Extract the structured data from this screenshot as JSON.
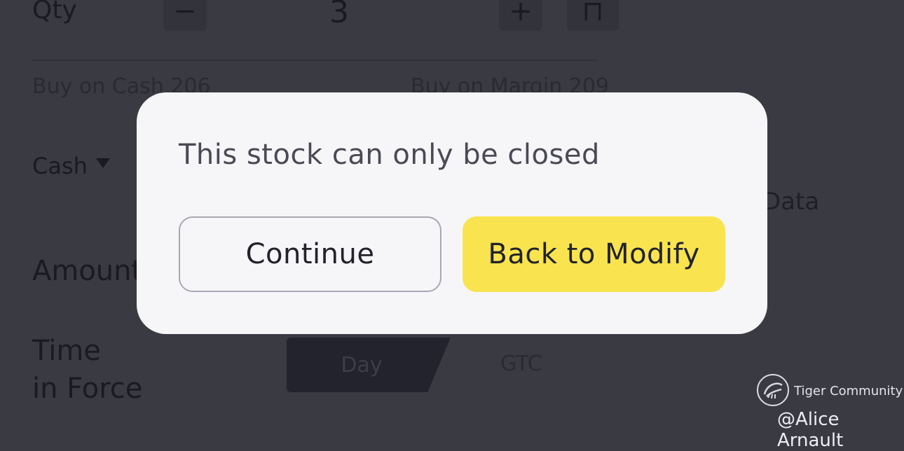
{
  "order_form": {
    "qty_label": "Qty",
    "qty_value": "3",
    "minus_symbol": "−",
    "plus_symbol": "+",
    "extra_symbol": "⊓",
    "buy_on_cash": "Buy on Cash 206",
    "buy_on_margin": "Buy on Margin 209",
    "account_type": "Cash",
    "data_link": "Data",
    "amount_label": "Amount",
    "time_in_force_line1": "Time",
    "time_in_force_line2": "in Force",
    "tif_options": [
      "Day",
      "GTC"
    ],
    "tif_selected": "Day"
  },
  "modal": {
    "message": "This stock can only be closed",
    "continue_label": "Continue",
    "back_label": "Back to Modify",
    "accent_color": "#f9e44f"
  },
  "watermark": {
    "community": "Tiger Community",
    "user": "@Alice Arnault"
  }
}
